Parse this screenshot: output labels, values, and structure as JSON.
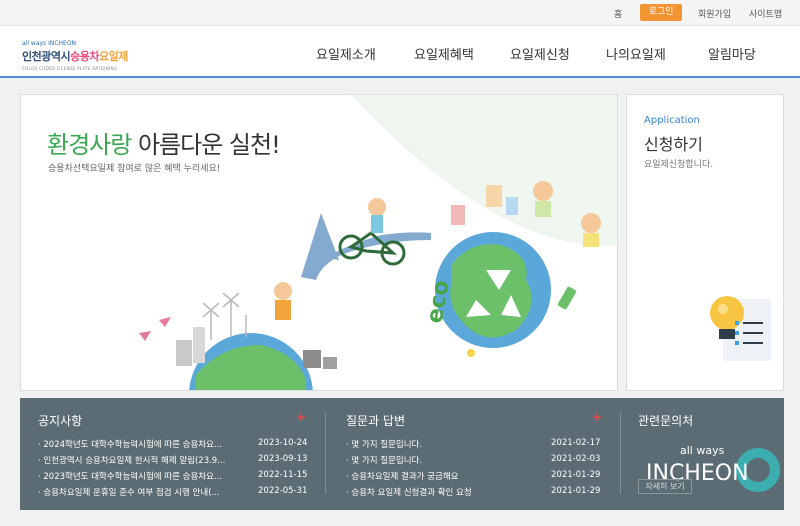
{
  "utility": {
    "home": "홈",
    "login": "로그인",
    "join": "회원가입",
    "sitemap": "사이트맵"
  },
  "logo": {
    "small": "all ways INCHEON",
    "main_a": "인천광역시",
    "main_b": "승용차",
    "main_c": "요일제",
    "sub": "COLOR CODED LICENSE PLATE RATIONING"
  },
  "nav": [
    "요일제소개",
    "요일제혜택",
    "요일제신청",
    "나의요일제",
    "알림마당"
  ],
  "hero": {
    "title_green": "환경사랑",
    "title_rest": " 아름다운 실천!",
    "subtitle": "승용차선택요일제 참여로 많은 혜택 누리세요!"
  },
  "apply": {
    "english": "Application",
    "title": "신청하기",
    "desc": "요일제신청합니다."
  },
  "notice": {
    "title": "공지사항",
    "items": [
      {
        "text": "· 2024학년도 대학수학능력시험에 따른 승용차요...",
        "date": "2023-10-24"
      },
      {
        "text": "· 인천광역시 승용차요일제 한시적 해제 알림(23.9...",
        "date": "2023-09-13"
      },
      {
        "text": "· 2023학년도 대학수학능력시험에 따른 승용차요...",
        "date": "2022-11-15"
      },
      {
        "text": "· 승용차요일제 운휴일 준수 여부 점검 시행 안내(...",
        "date": "2022-05-31"
      }
    ]
  },
  "qna": {
    "title": "질문과 답변",
    "items": [
      {
        "text": "· 몇 가지 질문입니다.",
        "date": "2021-02-17"
      },
      {
        "text": "· 몇 가지 질문입니다.",
        "date": "2021-02-03"
      },
      {
        "text": "· 승용차요일제 결과가 궁금해요",
        "date": "2021-01-29"
      },
      {
        "text": "· 승용차 요일제 신청결과 확인 요청",
        "date": "2021-01-29"
      }
    ]
  },
  "related": {
    "title": "관련문의처",
    "more": "자세히 보기",
    "brand_small": "all ways",
    "brand_big": "INCHEON"
  },
  "colors": {
    "accent": "#4a8fd6",
    "login": "#f39433",
    "green": "#3aa852",
    "bottom_bg": "#5c6c74"
  }
}
